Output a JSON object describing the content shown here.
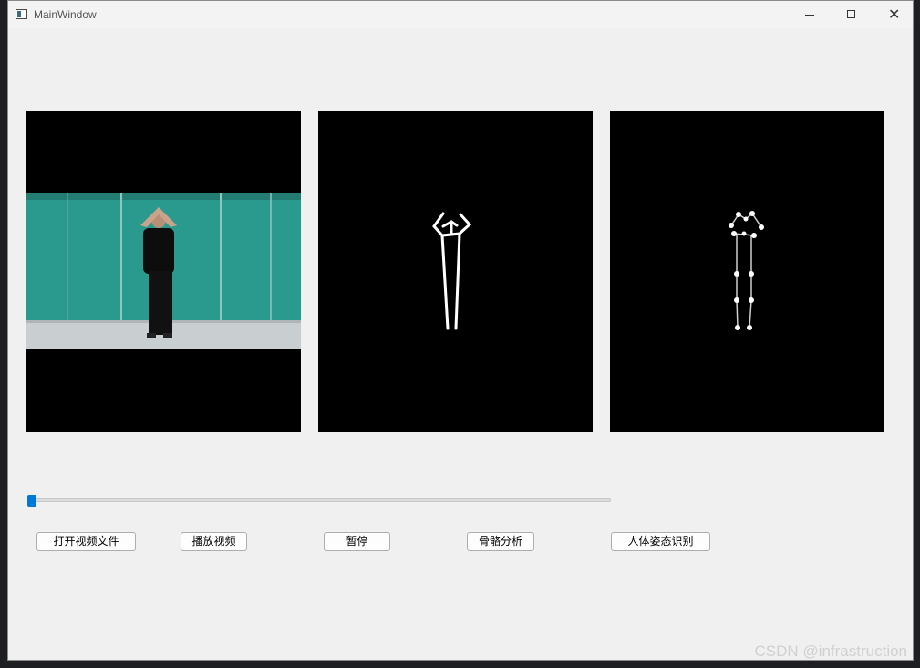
{
  "window": {
    "title": "MainWindow"
  },
  "buttons": {
    "open_video_file": "打开视频文件",
    "play_video": "播放视频",
    "pause": "暂停",
    "skeleton_analysis": "骨骼分析",
    "pose_recognition": "人体姿态识别"
  },
  "slider": {
    "value_fraction": 0.0
  },
  "icons": [
    "app-window-icon",
    "minimize-icon",
    "maximize-icon",
    "close-icon"
  ],
  "colors": {
    "accent": "#0078d7",
    "panel_bg": "#000000",
    "window_bg": "#f0f0f0"
  },
  "watermark": "CSDN @infrastruction"
}
